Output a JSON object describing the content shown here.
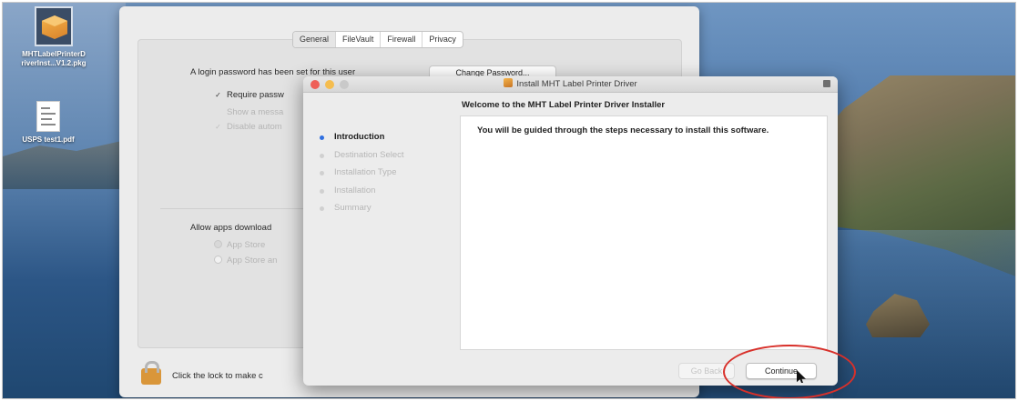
{
  "desktop": {
    "pkg_icon_label_line1": "MHTLabelPrinterD",
    "pkg_icon_label_line2": "riverInst...V1.2.pkg",
    "pdf_icon_label": "USPS test1.pdf"
  },
  "system_preferences": {
    "tabs": [
      "General",
      "FileVault",
      "Firewall",
      "Privacy"
    ],
    "active_tab": "General",
    "login_password_text": "A login password has been set for this user",
    "change_password_button": "Change Password...",
    "require_password_label": "Require passw",
    "show_message_label": "Show a messa",
    "disable_auto_label": "Disable autom",
    "allow_apps_label": "Allow apps download",
    "radio_app_store": "App Store",
    "radio_app_store_and": "App Store an",
    "lock_text": "Click the lock to make c"
  },
  "installer": {
    "window_title": "Install MHT Label Printer Driver",
    "welcome_heading": "Welcome to the MHT Label Printer Driver Installer",
    "steps": [
      "Introduction",
      "Destination Select",
      "Installation Type",
      "Installation",
      "Summary"
    ],
    "current_step": "Introduction",
    "body_text": "You will be guided through the steps necessary to install this software.",
    "go_back_button": "Go Back",
    "continue_button": "Continue"
  },
  "colors": {
    "annotation_ring": "#d8302a",
    "current_step_dot": "#2f6fe0",
    "close_button": "#ee5f57",
    "minimize_button": "#f5bd4f"
  }
}
